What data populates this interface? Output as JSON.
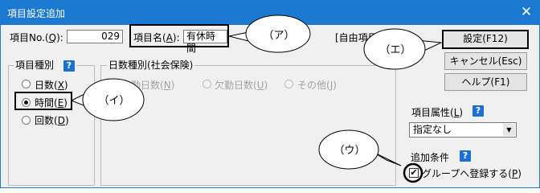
{
  "window": {
    "title": "項目設定追加",
    "close_glyph": "✕"
  },
  "item_no": {
    "label": "項目No.(Q):",
    "value": "029"
  },
  "item_name": {
    "label": "項目名(A):",
    "value": "有休時間"
  },
  "custom_item_label": "[自由項目",
  "item_type": {
    "legend": "項目種別",
    "options": [
      {
        "label": "日数(X)",
        "selected": false
      },
      {
        "label": "時間(E)",
        "selected": true
      },
      {
        "label": "回数(D)",
        "selected": false
      }
    ]
  },
  "days_type": {
    "legend": "日数種別(社会保険)",
    "options": [
      {
        "label": "出勤日数(N)",
        "enabled": false
      },
      {
        "label": "欠勤日数(U)",
        "enabled": false
      },
      {
        "label": "その他(J)",
        "enabled": false
      }
    ]
  },
  "buttons": {
    "ok": "設定(F12)",
    "cancel": "キャンセル(Esc)",
    "help": "ヘルプ(F1)"
  },
  "item_attribute": {
    "label": "項目属性(L)",
    "selected": "指定なし"
  },
  "additional_condition": {
    "label": "追加条件",
    "checkbox_label": "グループへ登録する(P)",
    "checked": true
  },
  "help_icon_glyph": "?",
  "callouts": {
    "a": "（ア）",
    "i": "（イ）",
    "u": "（ウ）",
    "e": "（エ）"
  },
  "colors": {
    "titlebar": "#1b79d2",
    "help_icon": "#1c6fd4",
    "window_bg": "#f0f0f0"
  }
}
